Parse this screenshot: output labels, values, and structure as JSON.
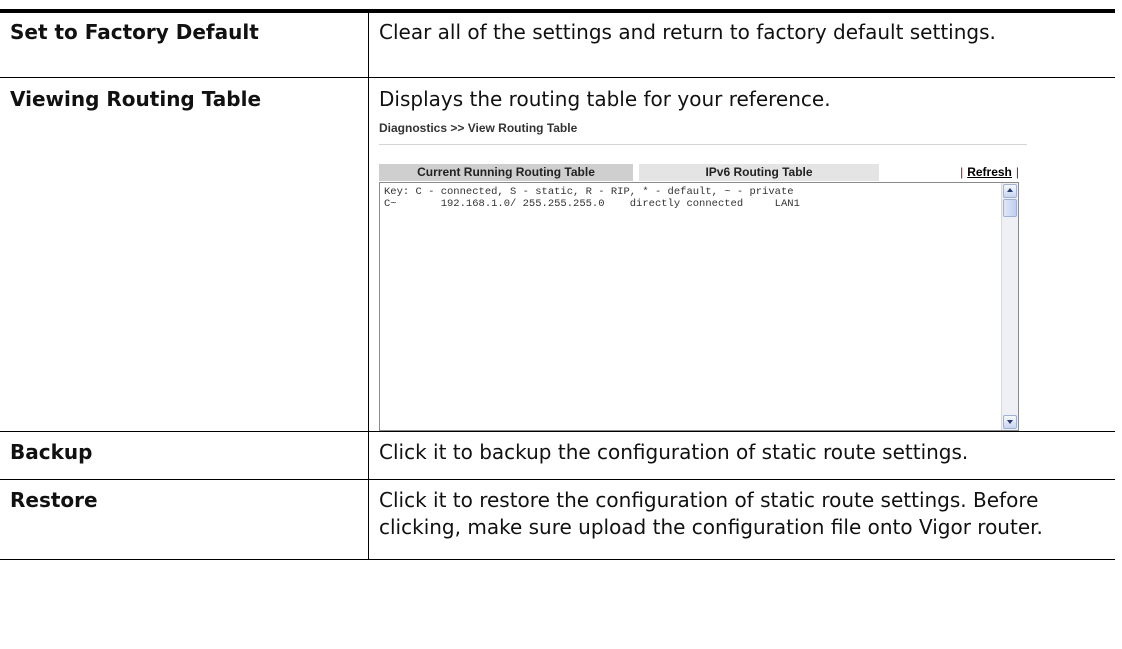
{
  "rows": [
    {
      "term": "Set to Factory Default",
      "description": "Clear all of the settings and return to factory default settings."
    },
    {
      "term": "Viewing Routing Table",
      "description": "Displays the routing table for your reference."
    },
    {
      "term": "Backup",
      "description": "Click it to backup the configuration of static route settings."
    },
    {
      "term": "Restore",
      "description": "Click it to restore the configuration of static route settings. Before clicking, make sure upload the configuration file onto Vigor router."
    }
  ],
  "screenshot": {
    "breadcrumb": "Diagnostics >> View Routing Table",
    "tabs": {
      "current": "Current Running Routing Table",
      "ipv6": "IPv6 Routing Table",
      "refresh": "Refresh",
      "separator": "|"
    },
    "routing_text": "Key: C - connected, S - static, R - RIP, * - default, ~ - private\nC~       192.168.1.0/ 255.255.255.0    directly connected     LAN1"
  }
}
